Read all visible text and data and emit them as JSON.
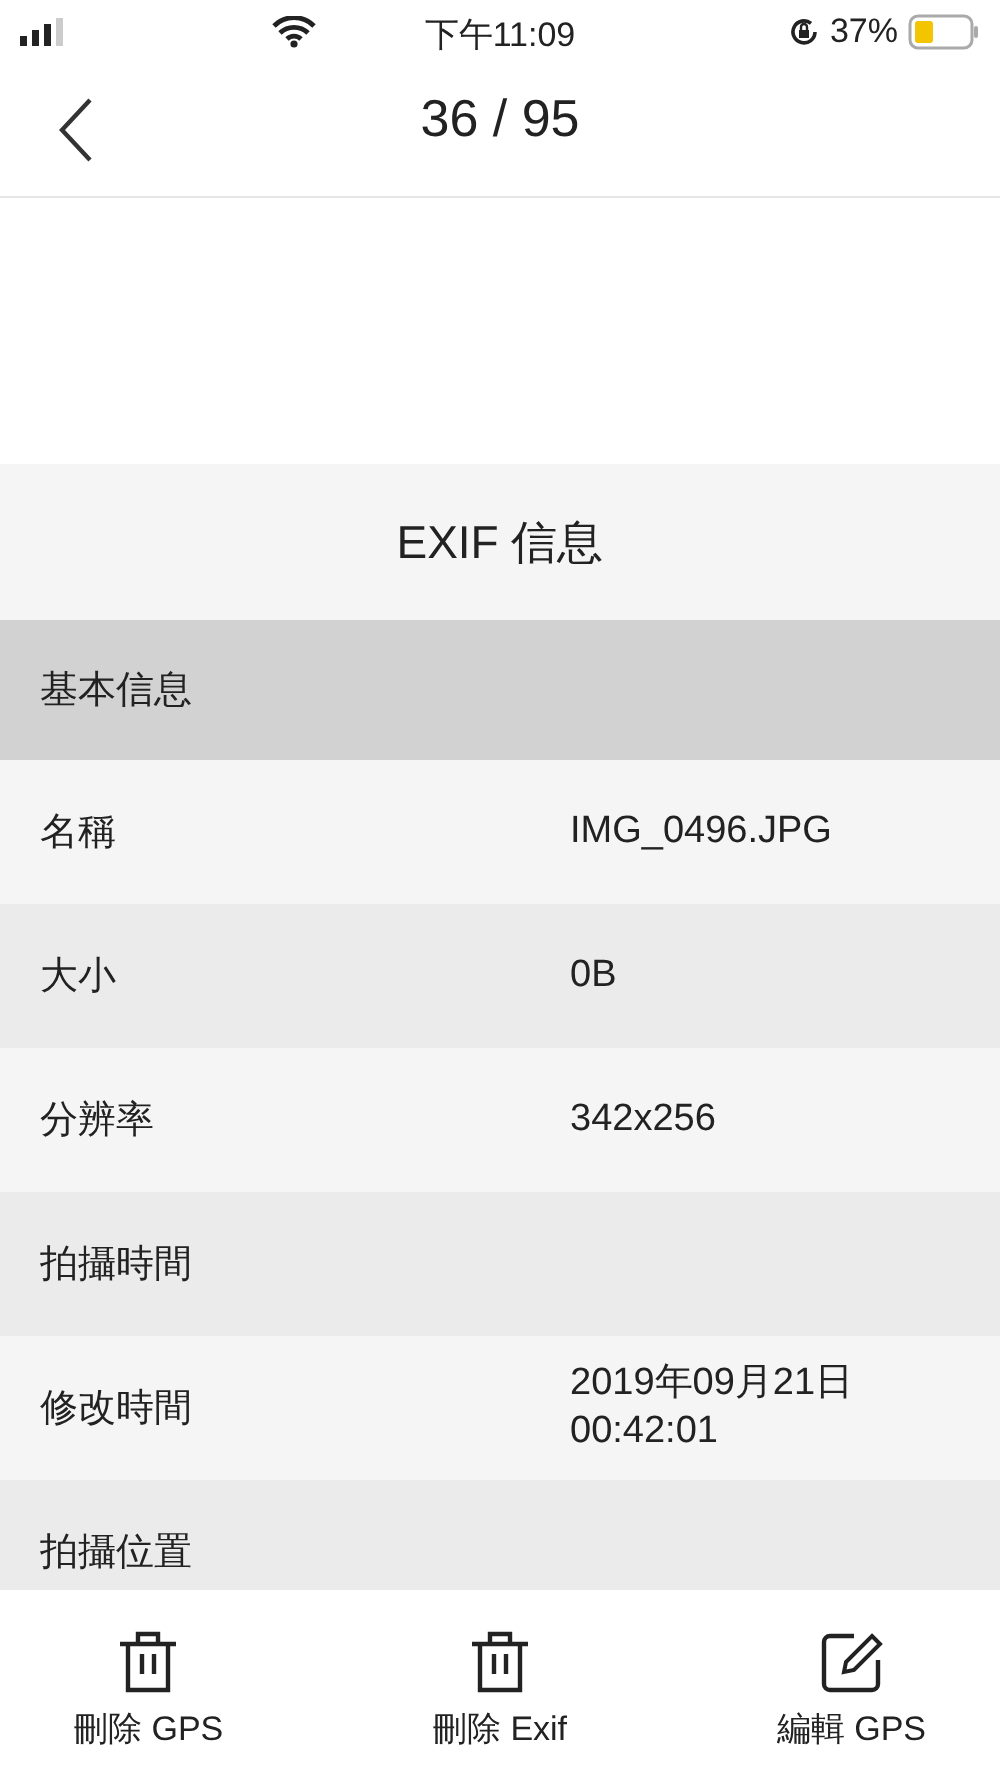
{
  "status_bar": {
    "time": "下午11:09",
    "battery": "37%"
  },
  "nav": {
    "title": "36 / 95"
  },
  "exif": {
    "title": "EXIF 信息",
    "rows": [
      {
        "kind": "section",
        "label": "基本信息"
      },
      {
        "kind": "field",
        "label": "名稱",
        "value": "IMG_0496.JPG"
      },
      {
        "kind": "field",
        "label": "大小",
        "value": "0B"
      },
      {
        "kind": "field",
        "label": "分辨率",
        "value": "342x256"
      },
      {
        "kind": "field",
        "label": "拍攝時間"
      },
      {
        "kind": "field",
        "label": "修改時間",
        "value": "2019年09月21日\n00:42:01"
      },
      {
        "kind": "field",
        "label": "拍攝位置"
      }
    ]
  },
  "toolbar": [
    {
      "kind": "trash",
      "label": "刪除 GPS"
    },
    {
      "kind": "trash",
      "label": "刪除 Exif"
    },
    {
      "kind": "edit",
      "label": "編輯 GPS"
    }
  ]
}
